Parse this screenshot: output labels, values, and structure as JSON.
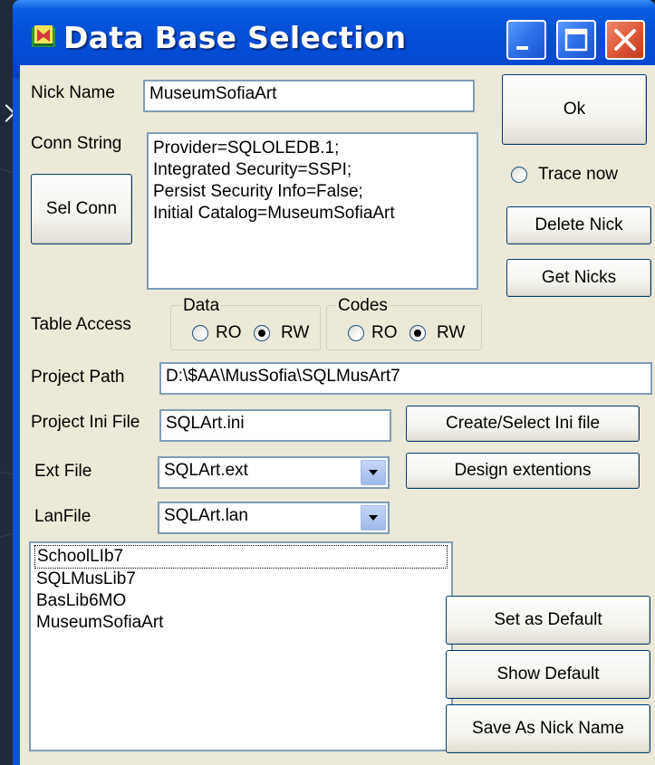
{
  "window": {
    "title": "Data Base Selection",
    "accent": "#0450d8",
    "close_color": "#e0583a"
  },
  "form": {
    "nick_name_label": "Nick Name",
    "nick_name_value": "MuseumSofiaArt",
    "conn_string_label": "Conn String",
    "conn_string_lines": [
      "Provider=SQLOLEDB.1;",
      "Integrated Security=SSPI;",
      "Persist Security Info=False;",
      "Initial Catalog=MuseumSofiaArt"
    ],
    "sel_conn_label": "Sel Conn",
    "ok_label": "Ok",
    "trace_now_label": "Trace now",
    "delete_nick_label": "Delete Nick",
    "get_nicks_label": "Get Nicks",
    "table_access_label": "Table Access",
    "data_group": {
      "title": "Data",
      "ro_label": "RO",
      "rw_label": "RW",
      "selected": "RW"
    },
    "codes_group": {
      "title": "Codes",
      "ro_label": "RO",
      "rw_label": "RW",
      "selected": "RW"
    },
    "project_path_label": "Project Path",
    "project_path_value": "D:\\$AA\\MusSofia\\SQLMusArt7",
    "project_ini_label": "Project Ini File",
    "project_ini_value": "SQLArt.ini",
    "create_ini_label": "Create/Select Ini file",
    "ext_file_label": "Ext File",
    "ext_file_value": "SQLArt.ext",
    "design_ext_label": "Design extentions",
    "lan_file_label": "LanFile",
    "lan_file_value": "SQLArt.lan",
    "nick_list": [
      "SchoolLIb7",
      "SQLMusLib7",
      "BasLib6MO",
      "MuseumSofiaArt"
    ],
    "set_default_label": "Set as Default",
    "show_default_label": "Show Default",
    "save_nick_label": "Save As Nick Name"
  },
  "icons": {
    "app": "book-icon",
    "minimize": "minimize-icon",
    "maximize": "maximize-icon",
    "close": "close-icon",
    "dropdown": "chevron-down-icon"
  }
}
